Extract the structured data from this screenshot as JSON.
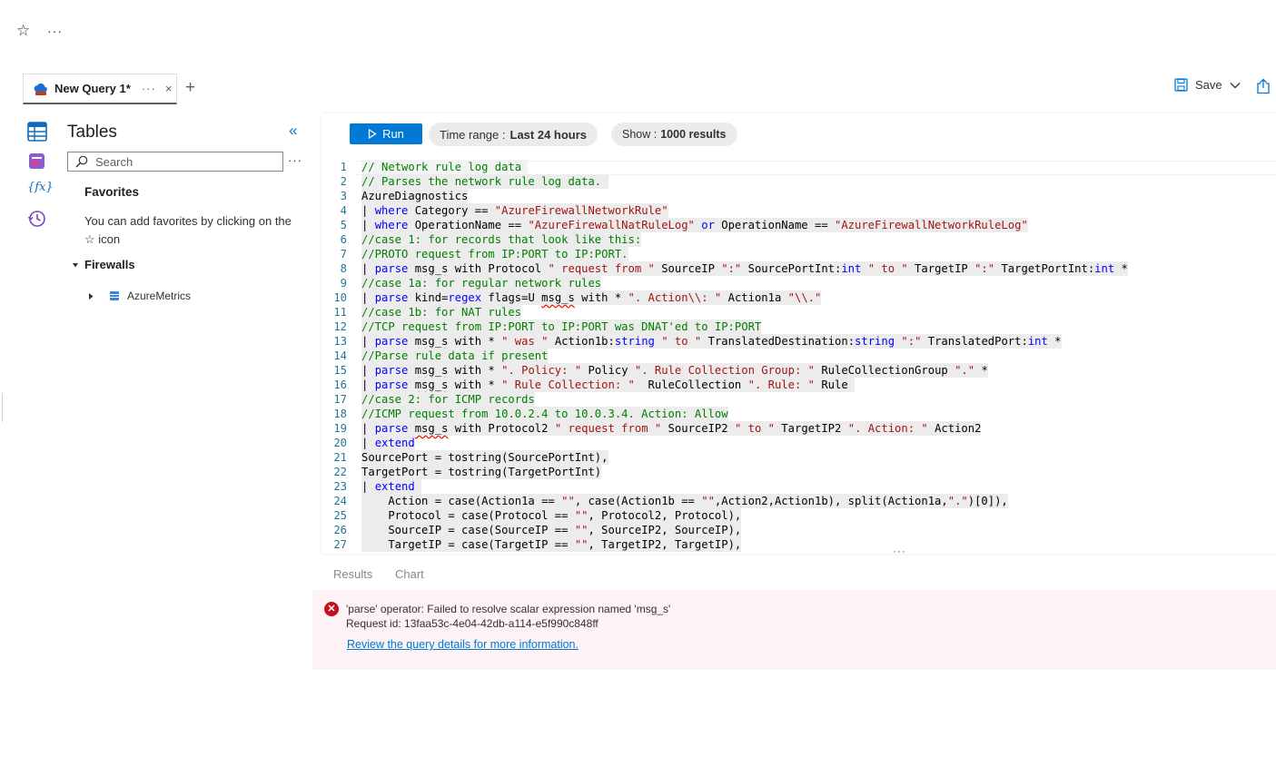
{
  "top_bar": {
    "star_icon": "☆",
    "more_icon": "···"
  },
  "tabs": {
    "active": {
      "label": "New Query 1*",
      "more": "···",
      "close": "×"
    },
    "add_icon": "+"
  },
  "toolbar": {
    "save_label": "Save"
  },
  "rail": {
    "icons": [
      "tables-icon",
      "queries-icon",
      "functions-icon",
      "history-icon"
    ],
    "functions_glyph": "{fx}"
  },
  "tables_pane": {
    "title": "Tables",
    "collapse_icon": "«",
    "search_placeholder": "Search",
    "more_icon": "···",
    "favorites_title": "Favorites",
    "favorites_hint_prefix": "You can add favorites by clicking on the",
    "favorites_hint_icon": "☆",
    "favorites_hint_suffix": "icon",
    "group": {
      "label": "Firewalls",
      "expanded": true
    },
    "items": [
      {
        "label": "AzureMetrics"
      }
    ]
  },
  "query_toolbar": {
    "run_label": "Run",
    "time_range_label": "Time range :",
    "time_range_value": "Last 24 hours",
    "show_label": "Show :",
    "show_value": "1000 results"
  },
  "editor": {
    "lines": [
      [
        [
          "c",
          "// Network rule log data"
        ],
        [
          "t",
          " "
        ]
      ],
      [
        [
          "c",
          "// Parses the network rule log data. "
        ]
      ],
      [
        [
          "t",
          "AzureDiagnostics"
        ]
      ],
      [
        [
          "t",
          "| "
        ],
        [
          "k",
          "where"
        ],
        [
          "t",
          " Category == "
        ],
        [
          "s",
          "\"AzureFirewallNetworkRule\""
        ]
      ],
      [
        [
          "t",
          "| "
        ],
        [
          "k",
          "where"
        ],
        [
          "t",
          " OperationName == "
        ],
        [
          "s",
          "\"AzureFirewallNatRuleLog\""
        ],
        [
          "t",
          " "
        ],
        [
          "k",
          "or"
        ],
        [
          "t",
          " OperationName == "
        ],
        [
          "s",
          "\"AzureFirewallNetworkRuleLog\""
        ]
      ],
      [
        [
          "c",
          "//case 1: for records that look like this:"
        ]
      ],
      [
        [
          "c",
          "//PROTO request from IP:PORT to IP:PORT."
        ]
      ],
      [
        [
          "t",
          "| "
        ],
        [
          "k",
          "parse"
        ],
        [
          "t",
          " "
        ],
        [
          "e",
          "msg_s"
        ],
        [
          "t",
          " with Protocol "
        ],
        [
          "s",
          "\" request from \""
        ],
        [
          "t",
          " SourceIP "
        ],
        [
          "s",
          "\":\""
        ],
        [
          "t",
          " SourcePortInt:"
        ],
        [
          "k",
          "int"
        ],
        [
          "t",
          " "
        ],
        [
          "s",
          "\" to \""
        ],
        [
          "t",
          " TargetIP "
        ],
        [
          "s",
          "\":\""
        ],
        [
          "t",
          " TargetPortInt:"
        ],
        [
          "k",
          "int"
        ],
        [
          "t",
          " *"
        ]
      ],
      [
        [
          "c",
          "//case 1a: for regular network rules"
        ]
      ],
      [
        [
          "t",
          "| "
        ],
        [
          "k",
          "parse"
        ],
        [
          "t",
          " kind="
        ],
        [
          "k",
          "regex"
        ],
        [
          "t",
          " flags=U "
        ],
        [
          "e",
          "msg_s"
        ],
        [
          "t",
          " with * "
        ],
        [
          "s",
          "\". Action\\\\: \""
        ],
        [
          "t",
          " Action1a "
        ],
        [
          "s",
          "\"\\\\.\""
        ]
      ],
      [
        [
          "c",
          "//case 1b: for NAT rules"
        ]
      ],
      [
        [
          "c",
          "//TCP request from IP:PORT to IP:PORT was DNAT'ed to IP:PORT"
        ]
      ],
      [
        [
          "t",
          "| "
        ],
        [
          "k",
          "parse"
        ],
        [
          "t",
          " "
        ],
        [
          "e",
          "msg_s"
        ],
        [
          "t",
          " with * "
        ],
        [
          "s",
          "\" was \""
        ],
        [
          "t",
          " Action1b:"
        ],
        [
          "k",
          "string"
        ],
        [
          "t",
          " "
        ],
        [
          "s",
          "\" to \""
        ],
        [
          "t",
          " TranslatedDestination:"
        ],
        [
          "k",
          "string"
        ],
        [
          "t",
          " "
        ],
        [
          "s",
          "\":\""
        ],
        [
          "t",
          " TranslatedPort:"
        ],
        [
          "k",
          "int"
        ],
        [
          "t",
          " *"
        ]
      ],
      [
        [
          "c",
          "//Parse rule data if present"
        ]
      ],
      [
        [
          "t",
          "| "
        ],
        [
          "k",
          "parse"
        ],
        [
          "t",
          " "
        ],
        [
          "e",
          "msg_s"
        ],
        [
          "t",
          " with * "
        ],
        [
          "s",
          "\". Policy: \""
        ],
        [
          "t",
          " Policy "
        ],
        [
          "s",
          "\". Rule Collection Group: \""
        ],
        [
          "t",
          " RuleCollectionGroup "
        ],
        [
          "s",
          "\".\""
        ],
        [
          "t",
          " *"
        ]
      ],
      [
        [
          "t",
          "| "
        ],
        [
          "k",
          "parse"
        ],
        [
          "t",
          " "
        ],
        [
          "e",
          "msg_s"
        ],
        [
          "t",
          " with * "
        ],
        [
          "s",
          "\" Rule Collection: \""
        ],
        [
          "t",
          "  RuleCollection "
        ],
        [
          "s",
          "\". Rule: \""
        ],
        [
          "t",
          " Rule "
        ]
      ],
      [
        [
          "c",
          "//case 2: for ICMP records"
        ]
      ],
      [
        [
          "c",
          "//ICMP request from 10.0.2.4 to 10.0.3.4. Action: Allow"
        ]
      ],
      [
        [
          "t",
          "| "
        ],
        [
          "k",
          "parse"
        ],
        [
          "t",
          " "
        ],
        [
          "e",
          "msg_s"
        ],
        [
          "t",
          " with Protocol2 "
        ],
        [
          "s",
          "\" request from \""
        ],
        [
          "t",
          " SourceIP2 "
        ],
        [
          "s",
          "\" to \""
        ],
        [
          "t",
          " TargetIP2 "
        ],
        [
          "s",
          "\". Action: \""
        ],
        [
          "t",
          " Action2"
        ]
      ],
      [
        [
          "t",
          "| "
        ],
        [
          "k",
          "extend"
        ]
      ],
      [
        [
          "t",
          "SourcePort = tostring(SourcePortInt),"
        ]
      ],
      [
        [
          "t",
          "TargetPort = tostring(TargetPortInt)"
        ]
      ],
      [
        [
          "t",
          "| "
        ],
        [
          "k",
          "extend"
        ],
        [
          "t",
          " "
        ]
      ],
      [
        [
          "t",
          "    Action = case(Action1a == "
        ],
        [
          "s",
          "\"\""
        ],
        [
          "t",
          ", case(Action1b == "
        ],
        [
          "s",
          "\"\""
        ],
        [
          "t",
          ",Action2,Action1b), split(Action1a,"
        ],
        [
          "s",
          "\".\""
        ],
        [
          "t",
          ")[0]),"
        ]
      ],
      [
        [
          "t",
          "    Protocol = case(Protocol == "
        ],
        [
          "s",
          "\"\""
        ],
        [
          "t",
          ", Protocol2, Protocol),"
        ]
      ],
      [
        [
          "t",
          "    SourceIP = case(SourceIP == "
        ],
        [
          "s",
          "\"\""
        ],
        [
          "t",
          ", SourceIP2, SourceIP),"
        ]
      ],
      [
        [
          "t",
          "    TargetIP = case(TargetIP == "
        ],
        [
          "s",
          "\"\""
        ],
        [
          "t",
          ", TargetIP2, TargetIP),"
        ]
      ]
    ]
  },
  "results": {
    "tabs": [
      "Results",
      "Chart"
    ],
    "error": {
      "message": "'parse' operator: Failed to resolve scalar expression named 'msg_s'",
      "request_id": "Request id: 13faa53c-4e04-42db-a114-e5f990c848ff",
      "link": "Review the query details for more information."
    }
  },
  "colors": {
    "accent": "#0078d4",
    "error": "#c50f1f",
    "error_bg": "#fdf3f4",
    "code_comment": "#008000",
    "code_keyword": "#0000ff",
    "code_string": "#a31515"
  }
}
